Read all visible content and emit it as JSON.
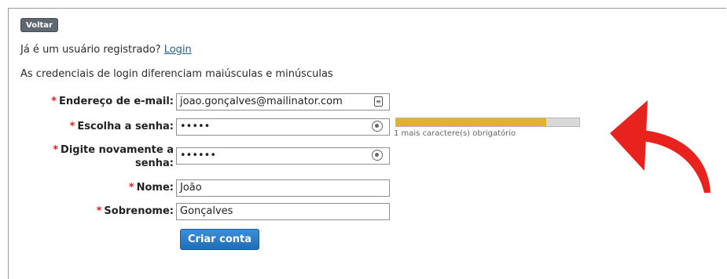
{
  "back_button": {
    "label": "Voltar"
  },
  "registered_prompt": {
    "text": "Já é um usuário registrado?",
    "link": "Login"
  },
  "case_notice": "As credenciais de login diferenciam maiúsculas e minúsculas",
  "required_mark": "*",
  "form": {
    "email": {
      "label": "Endereço de e-mail:",
      "value": "joao.gonçalves@mailinator.com"
    },
    "password": {
      "label": "Escolha a senha:",
      "value": "•••••"
    },
    "password_confirm": {
      "label_line1": "Digite novamente a",
      "label_line2": "senha:",
      "value": "••••••"
    },
    "first_name": {
      "label": "Nome:",
      "value": "João"
    },
    "last_name": {
      "label": "Sobrenome:",
      "value": "Gonçalves"
    }
  },
  "password_strength": {
    "fraction": 0.82,
    "hint": "1 mais caractere(s) obrigatório",
    "color": "#e2b22a"
  },
  "submit_button": {
    "label": "Criar conta"
  },
  "annotation": {
    "icon": "curved-arrow-icon",
    "color": "#e8231e"
  }
}
